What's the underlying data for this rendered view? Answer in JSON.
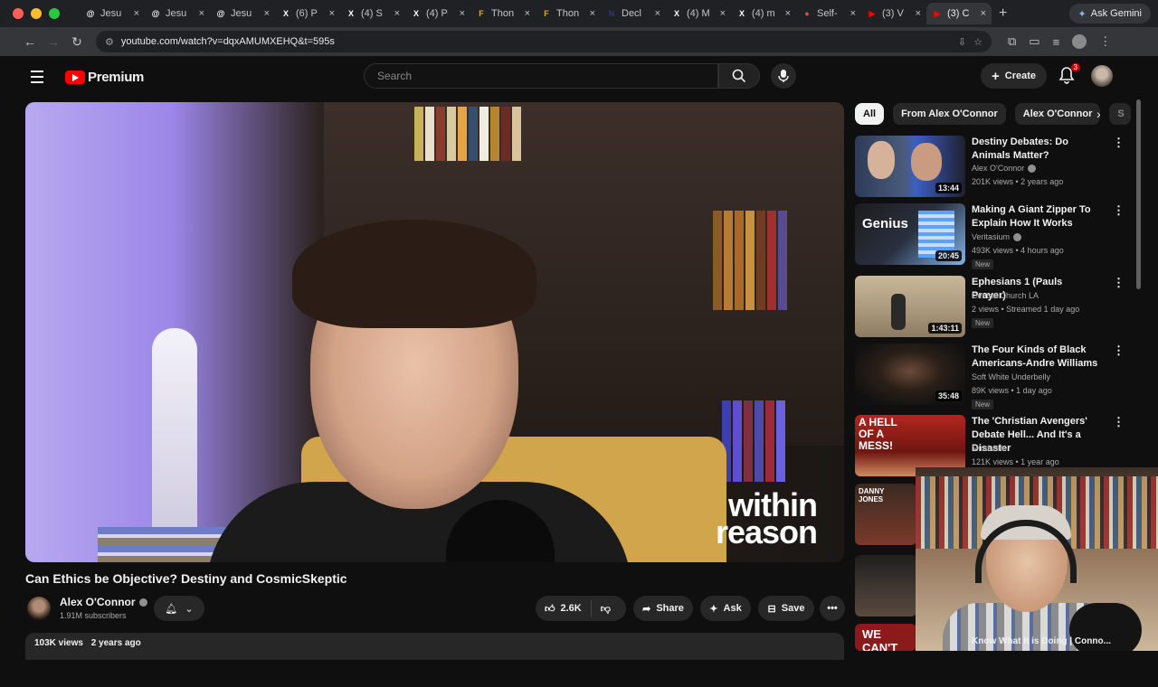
{
  "browser": {
    "tabs": [
      {
        "label": "Jesu",
        "icon": "threads-icon",
        "icon_char": "@",
        "icon_color": "#ffffff"
      },
      {
        "label": "Jesu",
        "icon": "threads-icon",
        "icon_char": "@",
        "icon_color": "#ffffff"
      },
      {
        "label": "Jesu",
        "icon": "threads-icon",
        "icon_char": "@",
        "icon_color": "#ffffff"
      },
      {
        "label": "(6) P",
        "icon": "x-icon",
        "icon_char": "X",
        "icon_color": "#ffffff"
      },
      {
        "label": "(4) S",
        "icon": "x-icon",
        "icon_char": "X",
        "icon_color": "#ffffff"
      },
      {
        "label": "(4) P",
        "icon": "x-icon",
        "icon_char": "X",
        "icon_color": "#ffffff"
      },
      {
        "label": "Thon",
        "icon": "f-icon",
        "icon_char": "F",
        "icon_color": "#e8a33a"
      },
      {
        "label": "Thon",
        "icon": "f-icon",
        "icon_char": "F",
        "icon_color": "#e8a33a"
      },
      {
        "label": "Decl",
        "icon": "n-icon",
        "icon_char": "N",
        "icon_color": "#2f3b7a"
      },
      {
        "label": "(4) M",
        "icon": "x-icon",
        "icon_char": "X",
        "icon_color": "#ffffff"
      },
      {
        "label": "(4) m",
        "icon": "x-icon",
        "icon_char": "X",
        "icon_color": "#ffffff"
      },
      {
        "label": "Self-",
        "icon": "pill-icon",
        "icon_char": "●",
        "icon_color": "#e04a3f"
      },
      {
        "label": "(3) V",
        "icon": "youtube-icon",
        "icon_char": "▶",
        "icon_color": "#ff0000"
      },
      {
        "label": "(3) C",
        "icon": "youtube-icon",
        "icon_char": "▶",
        "icon_color": "#ff0000"
      }
    ],
    "new_tab": "+",
    "gemini_label": "Ask Gemini",
    "url": "youtube.com/watch?v=dqxAMUMXEHQ&t=595s"
  },
  "youtube": {
    "logo_text": "Premium",
    "search_placeholder": "Search",
    "create_label": "Create",
    "notifications_count": "3"
  },
  "video": {
    "title": "Can Ethics be Objective? Destiny and CosmicSkeptic",
    "watermark_line1": "within",
    "watermark_line2": "reason",
    "channel": "Alex O'Connor",
    "subscribers": "1.91M subscribers",
    "likes": "2.6K",
    "share_label": "Share",
    "ask_label": "Ask",
    "save_label": "Save",
    "views": "103K views",
    "age": "2 years ago"
  },
  "chips": [
    "All",
    "From Alex O'Connor",
    "Alex O'Connor",
    "S"
  ],
  "recommendations": [
    {
      "title": "Destiny Debates: Do Animals Matter?",
      "channel": "Alex O'Connor",
      "verified": true,
      "meta": "201K views • 2 years ago",
      "duration": "13:44",
      "new": false,
      "thumb_text": ""
    },
    {
      "title": "Making A Giant Zipper To Explain How It Works",
      "channel": "Veritasium",
      "verified": true,
      "meta": "493K views • 4 hours ago",
      "duration": "20:45",
      "new": true,
      "thumb_text": "Genius"
    },
    {
      "title": "Ephesians 1 (Pauls Prayer)",
      "channel": "Central Church LA",
      "verified": false,
      "meta": "2 views • Streamed 1 day ago",
      "duration": "1:43:11",
      "new": true,
      "thumb_text": ""
    },
    {
      "title": "The Four Kinds of Black Americans-Andre Williams",
      "channel": "Soft White Underbelly",
      "verified": false,
      "meta": "89K views • 1 day ago",
      "duration": "35:48",
      "new": true,
      "thumb_text": ""
    },
    {
      "title": "The 'Christian Avengers' Debate Hell... And It's a Disaster",
      "channel": "Mindshift",
      "verified": false,
      "meta": "121K views • 1 year ago",
      "duration": "",
      "new": false,
      "thumb_text": "A HELL OF A MESS!"
    }
  ],
  "partial_thumbs": {
    "danny_jones": "DANNY JONES",
    "we_cant": "WE CAN'T"
  },
  "bottom_title": "Know What It is Doing | Conno..."
}
